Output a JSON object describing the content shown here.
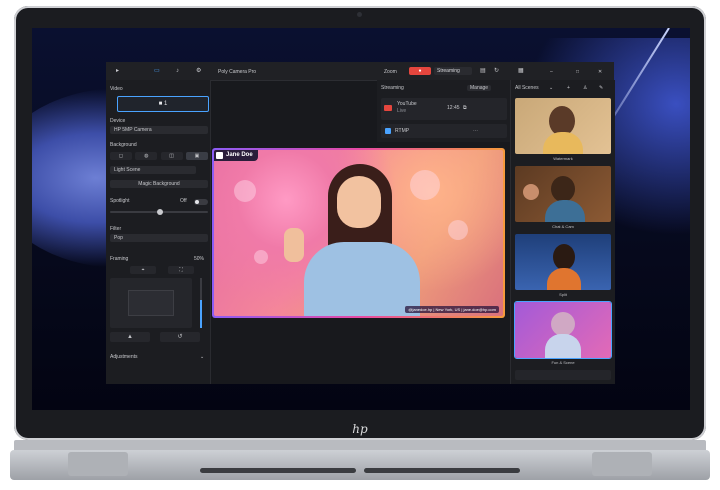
{
  "app": {
    "title": "Poly Camera Pro",
    "zoom_label": "Zoom",
    "record_label": "●",
    "streaming_label": "Streaming",
    "window_controls": [
      "–",
      "□",
      "✕"
    ]
  },
  "left_panel": {
    "video_label": "Video",
    "video_button": "■ 1",
    "device_label": "Device",
    "device_value": "HP 5MP Camera",
    "background_label": "Background",
    "background_value": "Light Scene",
    "magic_background_label": "Magic Background",
    "spotlight_label": "Spotlight",
    "spotlight_state": "Off",
    "filter_label": "Filter",
    "filter_value": "Pop",
    "framing_label": "Framing",
    "framing_value": "50%",
    "adjustments_label": "Adjustments"
  },
  "streaming_panel": {
    "title": "Streaming",
    "manage_label": "Manage",
    "youtube_label": "YouTube",
    "youtube_sub": "Live",
    "youtube_time": "12:45",
    "rtmp_label": "RTMP"
  },
  "preview": {
    "name_tag": "Jane Doe",
    "lower_third": "@janedoe.hp | New York, US | jane.doe@hp.com"
  },
  "scenes": {
    "header": "All Scenes",
    "items": [
      {
        "label": "Watermark"
      },
      {
        "label": "Chat & Cam"
      },
      {
        "label": "Split"
      },
      {
        "label": "Fun & Scene"
      }
    ]
  },
  "brand": {
    "logo_text": "hp"
  }
}
